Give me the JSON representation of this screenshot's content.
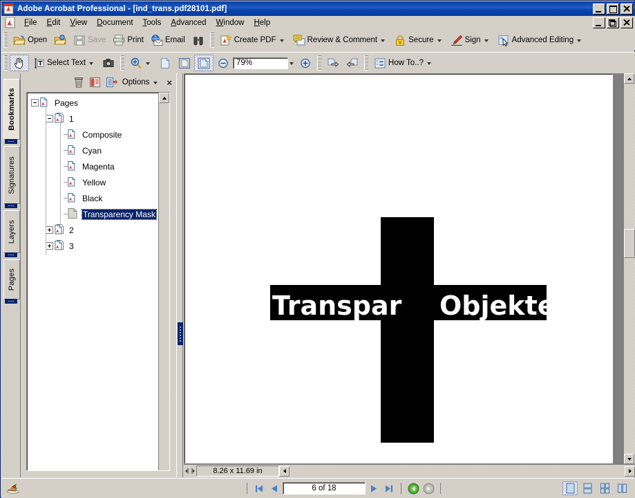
{
  "window": {
    "title": "Adobe Acrobat Professional - [ind_trans.pdf28101.pdf]",
    "app_icon": "acrobat-icon",
    "minimize_label": "Minimize",
    "maximize_label": "Maximize",
    "close_label": "Close",
    "restore_label": "Restore",
    "titlebar_color": "#0a3fa8"
  },
  "menu": {
    "icon": "acrobat-document-icon",
    "items": [
      {
        "label": "File",
        "accel": "F"
      },
      {
        "label": "Edit",
        "accel": "E"
      },
      {
        "label": "View",
        "accel": "V"
      },
      {
        "label": "Document",
        "accel": "D"
      },
      {
        "label": "Tools",
        "accel": "T"
      },
      {
        "label": "Advanced",
        "accel": "A"
      },
      {
        "label": "Window",
        "accel": "W"
      },
      {
        "label": "Help",
        "accel": "H"
      }
    ]
  },
  "toolbar_file": {
    "buttons": [
      {
        "label": "Open",
        "icon": "open-folder-icon",
        "enabled": true,
        "caret": false
      },
      {
        "label": "",
        "icon": "organizer-folder-icon",
        "enabled": true,
        "caret": false
      },
      {
        "label": "Save",
        "icon": "save-disk-icon",
        "enabled": false,
        "caret": false
      },
      {
        "label": "Print",
        "icon": "printer-icon",
        "enabled": true,
        "caret": false
      },
      {
        "label": "Email",
        "icon": "email-icon",
        "enabled": true,
        "caret": false
      },
      {
        "label": "",
        "icon": "search-binoculars-icon",
        "enabled": true,
        "caret": false
      }
    ]
  },
  "toolbar_tasks": {
    "buttons": [
      {
        "label": "Create PDF",
        "icon": "create-pdf-icon",
        "caret": true
      },
      {
        "label": "Review & Comment",
        "icon": "review-comment-icon",
        "caret": true
      },
      {
        "label": "Secure",
        "icon": "lock-icon",
        "caret": true
      },
      {
        "label": "Sign",
        "icon": "pen-sign-icon",
        "caret": true
      },
      {
        "label": "Advanced Editing",
        "icon": "advanced-editing-icon",
        "caret": true
      }
    ]
  },
  "toolbar_tools": {
    "hand_icon": "hand-tool-icon",
    "select_text_label": "Select Text",
    "select_text_icon": "select-text-icon",
    "snapshot_icon": "snapshot-camera-icon",
    "zoom_in_icon": "zoom-magnifier-icon",
    "fit_page_icon": "fit-page-icon",
    "fit_width_icon": "fit-width-icon",
    "fit_visible_icon": "fit-visible-icon",
    "zoom_out_icon": "zoom-out-minus-icon",
    "zoom_value": "79%",
    "zoom_plus_icon": "zoom-in-plus-icon",
    "prev_view_icon": "previous-view-icon",
    "next_view_icon": "next-view-icon",
    "how_to_label": "How To..?",
    "how_to_icon": "how-to-list-icon"
  },
  "nav_tabs": [
    {
      "label": "Bookmarks",
      "active": true
    },
    {
      "label": "Signatures",
      "active": false
    },
    {
      "label": "Layers",
      "active": false
    },
    {
      "label": "Pages",
      "active": false
    }
  ],
  "bookmarks_panel": {
    "delete_icon": "trash-icon",
    "expand_icon": "bookmark-book-icon",
    "new_bookmark_icon": "new-bookmark-icon",
    "options_label": "Options",
    "close_label": "×",
    "tree": [
      {
        "label": "Pages",
        "depth": 0,
        "toggle": "minus",
        "icon": "pdf-page-icon",
        "selected": false
      },
      {
        "label": "1",
        "depth": 1,
        "toggle": "minus",
        "icon": "pdf-pages-icon",
        "selected": false
      },
      {
        "label": "Composite",
        "depth": 2,
        "toggle": "leaf",
        "icon": "pdf-page-icon",
        "selected": false
      },
      {
        "label": "Cyan",
        "depth": 2,
        "toggle": "leaf",
        "icon": "pdf-page-icon",
        "selected": false
      },
      {
        "label": "Magenta",
        "depth": 2,
        "toggle": "leaf",
        "icon": "pdf-page-icon",
        "selected": false
      },
      {
        "label": "Yellow",
        "depth": 2,
        "toggle": "leaf",
        "icon": "pdf-page-icon",
        "selected": false
      },
      {
        "label": "Black",
        "depth": 2,
        "toggle": "leaf",
        "icon": "pdf-page-icon",
        "selected": false
      },
      {
        "label": "Transparency Mask",
        "depth": 2,
        "toggle": "leaf",
        "icon": "blank-page-icon",
        "selected": true
      },
      {
        "label": "2",
        "depth": 1,
        "toggle": "plus",
        "icon": "pdf-pages-icon",
        "selected": false
      },
      {
        "label": "3",
        "depth": 1,
        "toggle": "plus",
        "icon": "pdf-pages-icon",
        "selected": false
      }
    ],
    "selection_color": "#0a246a"
  },
  "document": {
    "text": "Transparente Objekte",
    "text_visible_left": "Transpar",
    "text_visible_right": "Objekte",
    "shape": "black-cross",
    "shape_color": "#000000",
    "band_color": "#000000",
    "text_color": "#ffffff",
    "page_background": "#ffffff",
    "page_size": "8.26 x 11.69 in"
  },
  "status": {
    "app_icon": "cake-slice-icon",
    "first_page_icon": "first-page-icon",
    "prev_page_icon": "previous-page-icon",
    "page_value": "6 of 18",
    "next_page_icon": "next-page-icon",
    "last_page_icon": "last-page-icon",
    "back_icon": "go-back-icon",
    "forward_icon": "go-forward-icon",
    "layout_buttons": [
      {
        "name": "single-page",
        "selected": true
      },
      {
        "name": "continuous",
        "selected": false
      },
      {
        "name": "facing",
        "selected": false
      },
      {
        "name": "continuous-facing",
        "selected": false
      }
    ]
  }
}
